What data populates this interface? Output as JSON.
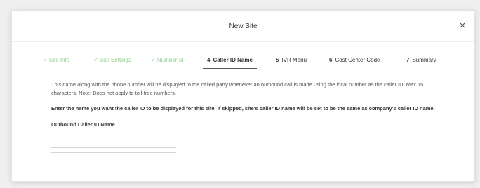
{
  "dialog": {
    "title": "New Site"
  },
  "steps": [
    {
      "label": "✓ Site Info",
      "state": "done"
    },
    {
      "label": "✓ Site Settings",
      "state": "done"
    },
    {
      "label": "✓ Number(s)",
      "state": "done"
    },
    {
      "number": "4",
      "label": "Caller ID Name",
      "state": "active"
    },
    {
      "number": "5",
      "label": "IVR Menu",
      "state": "pending"
    },
    {
      "number": "6",
      "label": "Cost Center Code",
      "state": "pending"
    },
    {
      "number": "7",
      "label": "Summary",
      "state": "pending"
    }
  ],
  "content": {
    "description": "This name along with the phone number will be displayed to the called party whenever an outbound call is made using the local number as the caller ID. Max 15 characters. Note: Does not apply to toll-free numbers.",
    "instruction": "Enter the name you want the caller ID to be displayed for this site. If skipped, site's caller ID name will be set to be the same as company's caller ID name.",
    "field_label": "Outbound Caller ID Name",
    "field_value": ""
  },
  "colors": {
    "done_step": "#8fce8f",
    "active_underline": "#555555"
  },
  "icons": {
    "close": "close-icon"
  }
}
